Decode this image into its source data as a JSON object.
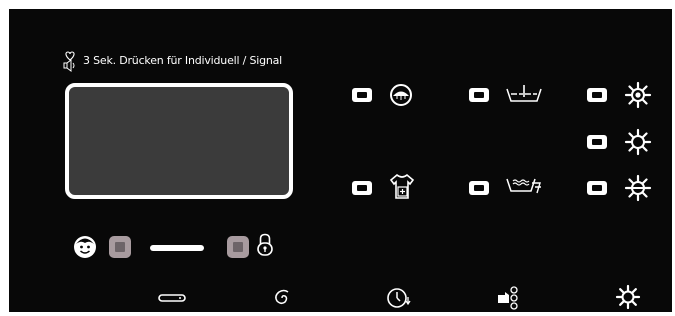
{
  "colors": {
    "panel_background": "#080808",
    "display_background": "#3b3b3b",
    "indicator_white": "#ffffff",
    "touch_key": "#a89b9f"
  },
  "header": {
    "hint_text": "3 Sek. Drücken für Individuell / Signal",
    "hint_icons": [
      "heart-icon",
      "speaker-icon"
    ]
  },
  "display": {
    "content": ""
  },
  "option_buttons": [
    {
      "id": "option-1",
      "icon": "drum-clean-icon"
    },
    {
      "id": "option-2",
      "icon": "prewash-tub-icon"
    },
    {
      "id": "option-3",
      "icon": "temperature-high-icon"
    },
    {
      "id": "option-4",
      "icon": "temperature-medium-icon"
    },
    {
      "id": "option-5",
      "icon": "shirt-plus-icon"
    },
    {
      "id": "option-6",
      "icon": "soak-wash-icon"
    },
    {
      "id": "option-7",
      "icon": "temperature-low-icon"
    }
  ],
  "bottom_controls": {
    "left_icon": "child-face-icon",
    "right_icon": "padlock-icon",
    "program_icons": [
      "key-icon",
      "spin-spiral-icon",
      "delayed-start-clock-icon",
      "hand-touch-icon",
      "settings-sun-icon"
    ]
  }
}
